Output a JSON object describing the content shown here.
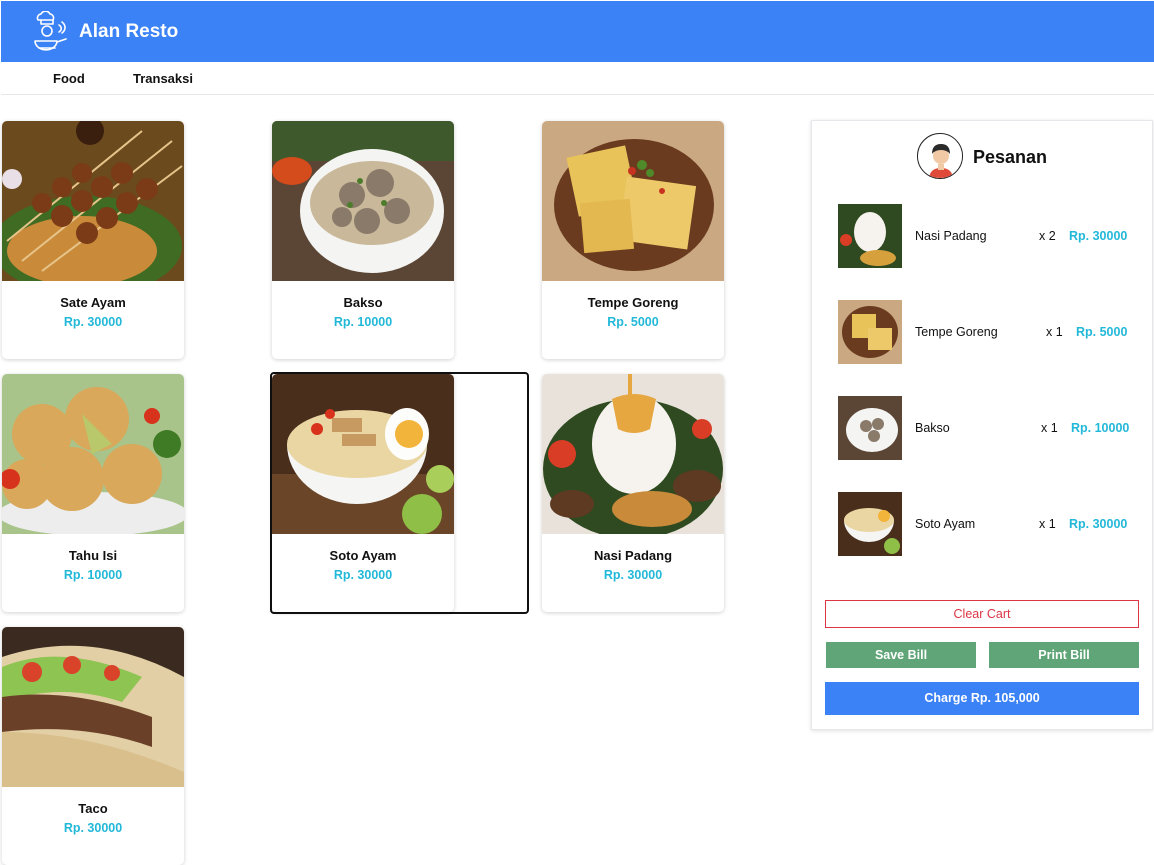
{
  "header": {
    "brand": "Alan Resto"
  },
  "nav": {
    "items": [
      {
        "label": "Food"
      },
      {
        "label": "Transaksi"
      }
    ]
  },
  "menu": {
    "items": [
      {
        "name": "Sate Ayam",
        "price": "Rp. 30000",
        "image": "sate-ayam-photo"
      },
      {
        "name": "Bakso",
        "price": "Rp. 10000",
        "image": "bakso-photo"
      },
      {
        "name": "Tempe Goreng",
        "price": "Rp. 5000",
        "image": "tempe-goreng-photo"
      },
      {
        "name": "Tahu Isi",
        "price": "Rp. 10000",
        "image": "tahu-isi-photo"
      },
      {
        "name": "Soto Ayam",
        "price": "Rp. 30000",
        "image": "soto-ayam-photo",
        "selected": true
      },
      {
        "name": "Nasi Padang",
        "price": "Rp. 30000",
        "image": "nasi-padang-photo"
      },
      {
        "name": "Taco",
        "price": "Rp. 30000",
        "image": "taco-photo"
      }
    ]
  },
  "order": {
    "title": "Pesanan",
    "items": [
      {
        "name": "Nasi Padang",
        "qty": "x 2",
        "price": "Rp. 30000"
      },
      {
        "name": "Tempe Goreng",
        "qty": "x 1",
        "price": "Rp. 5000"
      },
      {
        "name": "Bakso",
        "qty": "x 1",
        "price": "Rp. 10000"
      },
      {
        "name": "Soto Ayam",
        "qty": "x 1",
        "price": "Rp. 30000"
      }
    ],
    "clear_label": "Clear Cart",
    "save_label": "Save Bill",
    "print_label": "Print Bill",
    "charge_label": "Charge Rp. 105,000"
  },
  "colors": {
    "primary": "#3b82f6",
    "price": "#22b8d8",
    "success": "#5fa577",
    "danger": "#dc3545"
  }
}
